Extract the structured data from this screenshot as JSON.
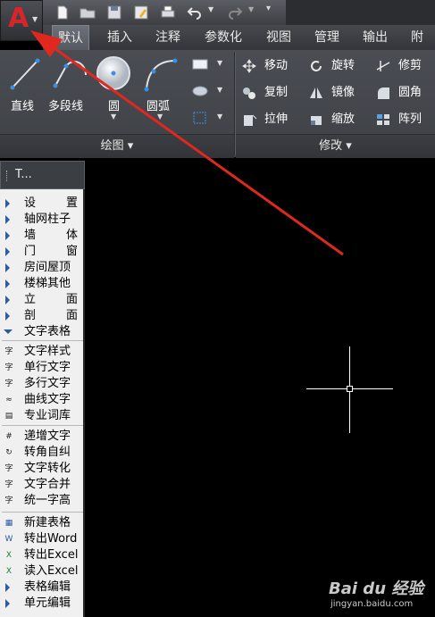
{
  "app": {
    "logo_letter": "A"
  },
  "tabs": [
    {
      "label": "默认",
      "active": true
    },
    {
      "label": "插入"
    },
    {
      "label": "注释"
    },
    {
      "label": "参数化"
    },
    {
      "label": "视图"
    },
    {
      "label": "管理"
    },
    {
      "label": "输出"
    },
    {
      "label": "附加"
    }
  ],
  "ribbon": {
    "draw": {
      "big_tools": [
        {
          "label": "直线",
          "icon": "line-icon"
        },
        {
          "label": "多段线",
          "icon": "polyline-icon"
        },
        {
          "label": "圆",
          "icon": "circle-icon"
        },
        {
          "label": "圆弧",
          "icon": "arc-icon"
        }
      ],
      "panel_title": "绘图 ▾"
    },
    "modify": {
      "tools": [
        {
          "label": "移动",
          "icon": "move-icon"
        },
        {
          "label": "旋转",
          "icon": "rotate-icon"
        },
        {
          "label": "修剪",
          "icon": "trim-icon"
        },
        {
          "label": "复制",
          "icon": "copy-icon"
        },
        {
          "label": "镜像",
          "icon": "mirror-icon"
        },
        {
          "label": "圆角",
          "icon": "fillet-icon"
        },
        {
          "label": "拉伸",
          "icon": "stretch-icon"
        },
        {
          "label": "缩放",
          "icon": "scale-icon"
        },
        {
          "label": "阵列",
          "icon": "array-icon"
        }
      ],
      "panel_title": "修改 ▾"
    }
  },
  "palette": {
    "title": "T...",
    "groups": [
      {
        "label": "设　　置",
        "expanded": false
      },
      {
        "label": "轴网柱子",
        "expanded": false
      },
      {
        "label": "墙　　体",
        "expanded": false
      },
      {
        "label": "门　　窗",
        "expanded": false
      },
      {
        "label": "房间屋顶",
        "expanded": false
      },
      {
        "label": "楼梯其他",
        "expanded": false
      },
      {
        "label": "立　　面",
        "expanded": false
      },
      {
        "label": "剖　　面",
        "expanded": false
      },
      {
        "label": "文字表格",
        "expanded": true
      }
    ],
    "text_tools": [
      {
        "label": "文字样式",
        "icon": "text-style-icon"
      },
      {
        "label": "单行文字",
        "icon": "single-line-text-icon"
      },
      {
        "label": "多行文字",
        "icon": "multiline-text-icon"
      },
      {
        "label": "曲线文字",
        "icon": "curve-text-icon"
      },
      {
        "label": "专业词库",
        "icon": "dictionary-icon"
      }
    ],
    "text_tools2": [
      {
        "label": "递增文字",
        "icon": "increment-text-icon"
      },
      {
        "label": "转角自纠",
        "icon": "angle-fix-icon"
      },
      {
        "label": "文字转化",
        "icon": "text-convert-icon"
      },
      {
        "label": "文字合并",
        "icon": "text-merge-icon"
      },
      {
        "label": "统一字高",
        "icon": "text-height-icon"
      }
    ],
    "table_tools": [
      {
        "label": "新建表格",
        "icon": "new-table-icon"
      },
      {
        "label": "转出Word",
        "icon": "export-word-icon"
      },
      {
        "label": "转出Excel",
        "icon": "export-excel-icon"
      },
      {
        "label": "读入Excel",
        "icon": "import-excel-icon"
      },
      {
        "label": "表格编辑",
        "icon": "arrow-right-icon"
      },
      {
        "label": "单元编辑",
        "icon": "arrow-right-icon"
      }
    ]
  },
  "watermark": {
    "brand": "Bai du 经验",
    "url": "jingyan.baidu.com"
  },
  "colors": {
    "annotation_arrow": "#e0281f",
    "logo": "#d7262b",
    "canvas": "#000000"
  }
}
